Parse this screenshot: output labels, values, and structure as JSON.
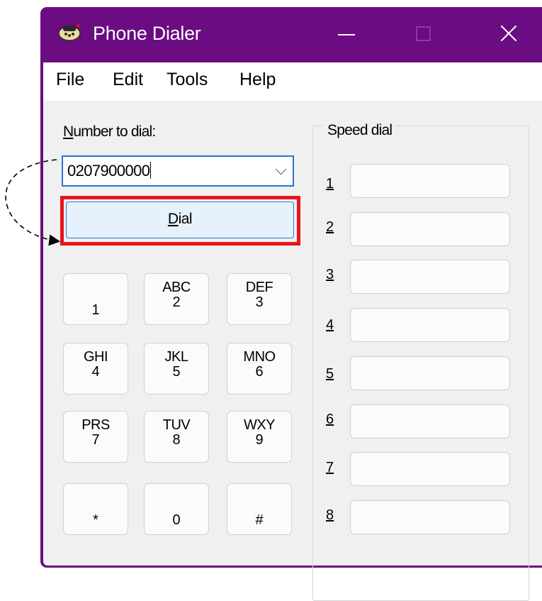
{
  "window": {
    "title": "Phone Dialer",
    "accent": "#6b0c82"
  },
  "titlebar": {
    "icon": "phone-dialer-app-icon",
    "controls": [
      "minimize",
      "maximize",
      "close"
    ]
  },
  "menu": {
    "items": [
      "File",
      "Edit",
      "Tools",
      "Help"
    ]
  },
  "dialer": {
    "number_label_underlined": "N",
    "number_label_rest": "umber to dial:",
    "number_value": "0207900000",
    "dial_label_underlined": "D",
    "dial_label_rest": "ial"
  },
  "keypad": [
    {
      "letters": "",
      "digit": "1"
    },
    {
      "letters": "ABC",
      "digit": "2"
    },
    {
      "letters": "DEF",
      "digit": "3"
    },
    {
      "letters": "GHI",
      "digit": "4"
    },
    {
      "letters": "JKL",
      "digit": "5"
    },
    {
      "letters": "MNO",
      "digit": "6"
    },
    {
      "letters": "PRS",
      "digit": "7"
    },
    {
      "letters": "TUV",
      "digit": "8"
    },
    {
      "letters": "WXY",
      "digit": "9"
    },
    {
      "letters": "",
      "digit": "*"
    },
    {
      "letters": "",
      "digit": "0"
    },
    {
      "letters": "",
      "digit": "#"
    }
  ],
  "speed_dial": {
    "title": "Speed dial",
    "entries": [
      {
        "number": "1",
        "label": ""
      },
      {
        "number": "2",
        "label": ""
      },
      {
        "number": "3",
        "label": ""
      },
      {
        "number": "4",
        "label": ""
      },
      {
        "number": "5",
        "label": ""
      },
      {
        "number": "6",
        "label": ""
      },
      {
        "number": "7",
        "label": ""
      },
      {
        "number": "8",
        "label": ""
      }
    ]
  },
  "annotation": {
    "highlight_color": "#e4161c"
  }
}
